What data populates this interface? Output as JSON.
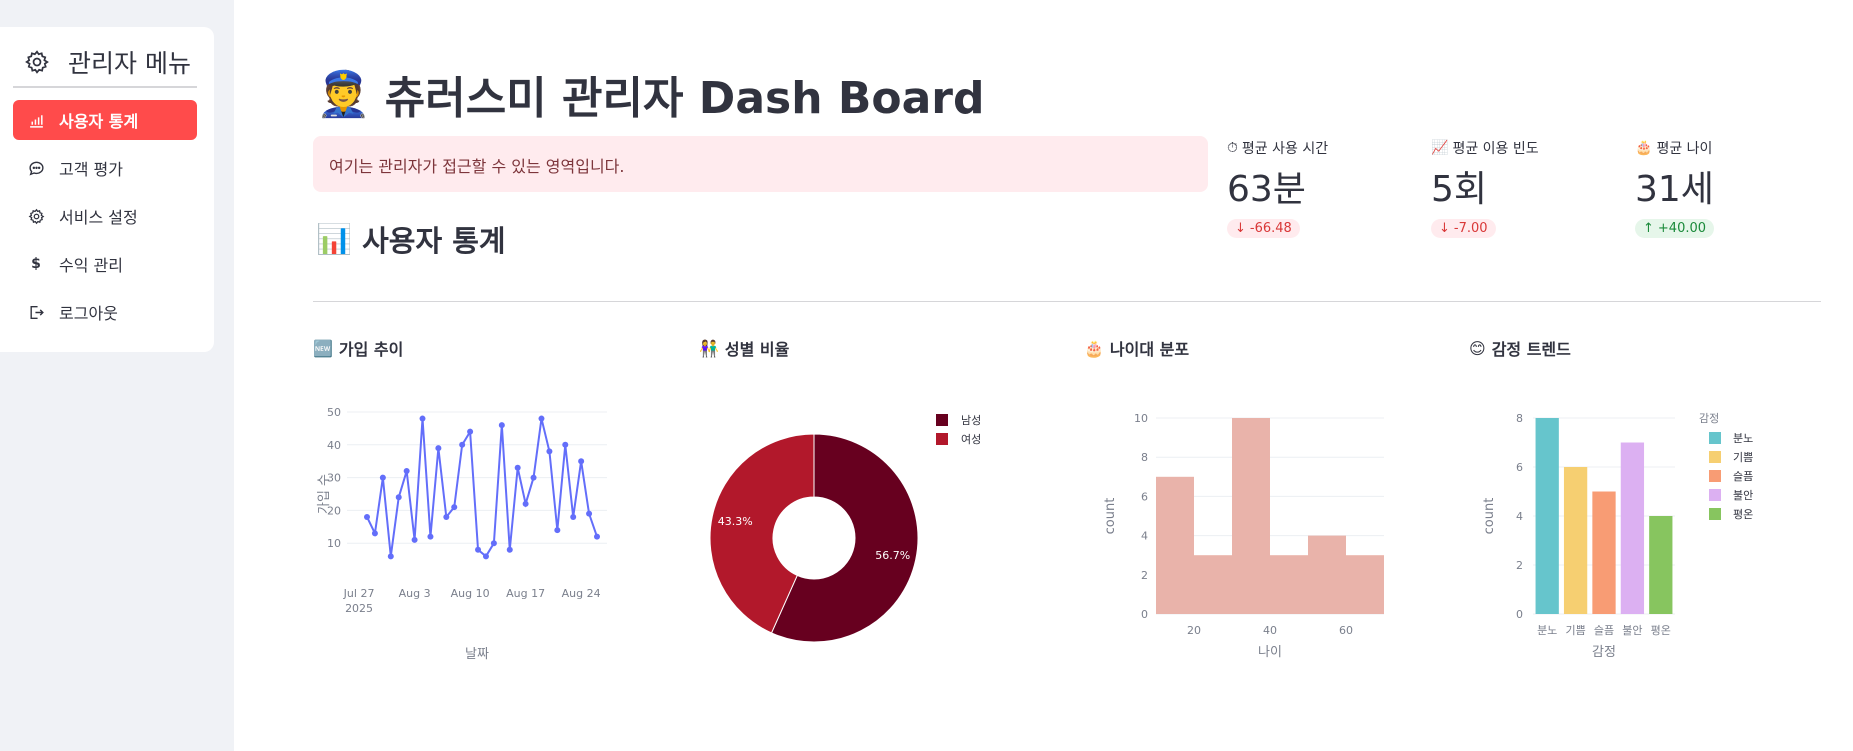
{
  "sidebar": {
    "title": "관리자 메뉴",
    "items": [
      {
        "label": "사용자 통계",
        "icon": "bar-chart-icon",
        "active": true
      },
      {
        "label": "고객 평가",
        "icon": "chat-bubble-icon",
        "active": false
      },
      {
        "label": "서비스 설정",
        "icon": "gear-icon",
        "active": false
      },
      {
        "label": "수익 관리",
        "icon": "dollar-icon",
        "active": false
      },
      {
        "label": "로그아웃",
        "icon": "logout-icon",
        "active": false
      }
    ]
  },
  "header": {
    "title_emoji": "👮",
    "title": "츄러스미 관리자 Dash Board",
    "info": "여기는 관리자가 접근할 수 있는 영역입니다.",
    "section_emoji": "📊",
    "section_title": "사용자 통계"
  },
  "metrics": [
    {
      "emoji": "⏱",
      "label": "평균 사용 시간",
      "value": "63분",
      "delta": "-66.48",
      "direction": "down"
    },
    {
      "emoji": "📈",
      "label": "평균 이용 빈도",
      "value": "5회",
      "delta": "-7.00",
      "direction": "down"
    },
    {
      "emoji": "🎂",
      "label": "평균 나이",
      "value": "31세",
      "delta": "+40.00",
      "direction": "up"
    }
  ],
  "charts": {
    "signup": {
      "emoji": "🆕",
      "title": "가입 추이"
    },
    "gender": {
      "emoji": "👫",
      "title": "성별 비율"
    },
    "age": {
      "emoji": "🎂",
      "title": "나이대 분포"
    },
    "emotion": {
      "emoji": "😊",
      "title": "감정 트렌드"
    }
  },
  "chart_data": [
    {
      "type": "line",
      "xlabel": "날짜",
      "ylabel": "가입 수",
      "x_tick_labels": [
        "Jul 27",
        "Aug 3",
        "Aug 10",
        "Aug 17",
        "Aug 24"
      ],
      "x_tick_sublabel": "2025",
      "ylim": [
        0,
        50
      ],
      "y_ticks": [
        10,
        20,
        30,
        40,
        50
      ],
      "x_start": "2025-07-28",
      "values": [
        18,
        13,
        30,
        6,
        24,
        32,
        11,
        48,
        12,
        39,
        18,
        21,
        40,
        44,
        8,
        6,
        10,
        46,
        8,
        33,
        22,
        30,
        48,
        38,
        14,
        40,
        18,
        35,
        19,
        12
      ],
      "color": "#636efa"
    },
    {
      "type": "pie",
      "hole": 0.3,
      "legend_position": "top-right",
      "slices": [
        {
          "name": "남성",
          "value": 56.7,
          "label": "56.7%",
          "color": "#67001f"
        },
        {
          "name": "여성",
          "value": 43.3,
          "label": "43.3%",
          "color": "#b2182b"
        }
      ]
    },
    {
      "type": "bar",
      "subtype": "histogram",
      "xlabel": "나이",
      "ylabel": "count",
      "bins": [
        [
          10,
          20
        ],
        [
          20,
          30
        ],
        [
          30,
          40
        ],
        [
          40,
          50
        ],
        [
          50,
          60
        ],
        [
          60,
          70
        ]
      ],
      "values": [
        7,
        3,
        10,
        3,
        4,
        3
      ],
      "x_ticks": [
        20,
        40,
        60
      ],
      "xlim": [
        10,
        70
      ],
      "ylim": [
        0,
        10
      ],
      "y_ticks": [
        0,
        2,
        4,
        6,
        8,
        10
      ],
      "color": "#e9b3aa"
    },
    {
      "type": "bar",
      "xlabel": "감정",
      "ylabel": "count",
      "legend_title": "감정",
      "legend_position": "top-right",
      "categories": [
        "분노",
        "기쁨",
        "슬픔",
        "불안",
        "평온"
      ],
      "values": [
        8,
        6,
        5,
        7,
        4
      ],
      "colors": [
        "#66c5cc",
        "#f6cf71",
        "#f89c74",
        "#dcb0f2",
        "#87c55f"
      ],
      "ylim": [
        0,
        8
      ],
      "y_ticks": [
        0,
        2,
        4,
        6,
        8
      ]
    }
  ]
}
